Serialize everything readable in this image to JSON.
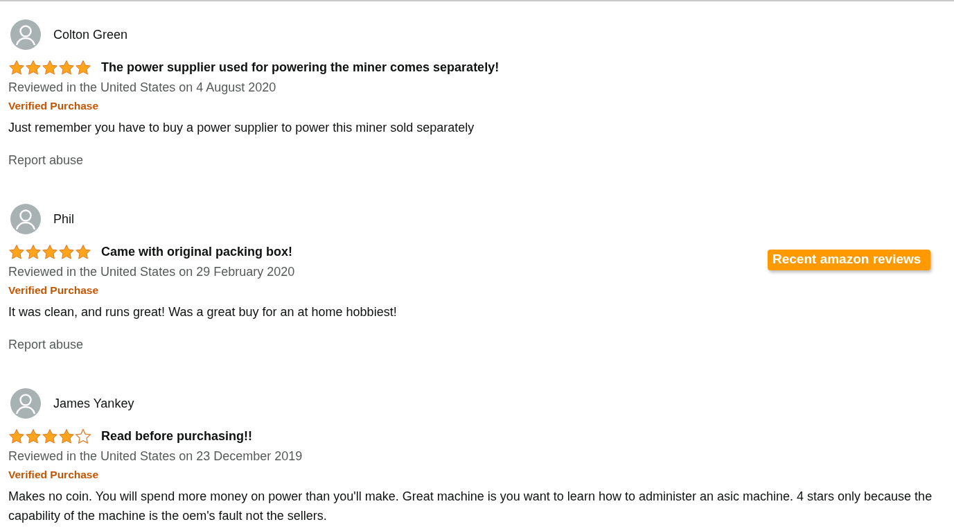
{
  "reviews": [
    {
      "author": "Colton Green",
      "stars": 5,
      "title": "The power supplier used for powering the miner comes separately!",
      "date": "Reviewed in the United States on 4 August 2020",
      "verified": "Verified Purchase",
      "body": "Just remember you have to buy a power supplier to power this miner sold separately",
      "report": "Report abuse"
    },
    {
      "author": "Phil",
      "stars": 5,
      "title": "Came with original packing box!",
      "date": "Reviewed in the United States on 29 February 2020",
      "verified": "Verified Purchase",
      "body": "It was clean, and runs great! Was a great buy for an at home hobbiest!",
      "report": "Report abuse"
    },
    {
      "author": "James Yankey",
      "stars": 4,
      "title": "Read before purchasing!!",
      "date": "Reviewed in the United States on 23 December 2019",
      "verified": "Verified Purchase",
      "body": "Makes no coin. You will spend more money on power than you'll make. Great machine is you want to learn how to administer an asic machine. 4 stars only because the capability of the machine is the oem's fault not the sellers."
    }
  ],
  "badge": {
    "text": "Recent amazon reviews"
  }
}
